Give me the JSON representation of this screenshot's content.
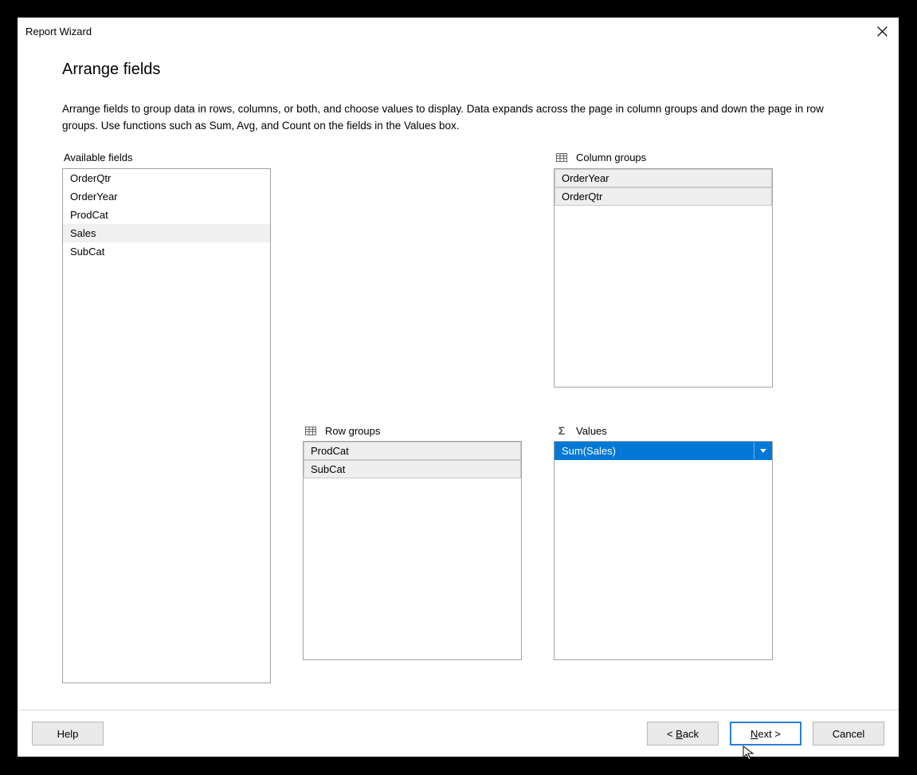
{
  "window": {
    "title": "Report Wizard"
  },
  "page": {
    "heading": "Arrange fields",
    "description": "Arrange fields to group data in rows, columns, or both, and choose values to display. Data expands across the page in column groups and down the page in row groups.  Use functions such as Sum, Avg, and Count on the fields in the Values box."
  },
  "labels": {
    "available": "Available fields",
    "column_groups": "Column groups",
    "row_groups": "Row groups",
    "values": "Values"
  },
  "available_fields": [
    {
      "name": "OrderQtr",
      "selected": false
    },
    {
      "name": "OrderYear",
      "selected": false
    },
    {
      "name": "ProdCat",
      "selected": false
    },
    {
      "name": "Sales",
      "selected": true
    },
    {
      "name": "SubCat",
      "selected": false
    }
  ],
  "column_groups": [
    {
      "name": "OrderYear"
    },
    {
      "name": "OrderQtr"
    }
  ],
  "row_groups": [
    {
      "name": "ProdCat"
    },
    {
      "name": "SubCat"
    }
  ],
  "values": [
    {
      "name": "Sum(Sales)",
      "selected": true
    }
  ],
  "buttons": {
    "help": "Help",
    "back_prefix": "< ",
    "back_u": "B",
    "back_rest": "ack",
    "next_u": "N",
    "next_rest": "ext >",
    "cancel": "Cancel"
  }
}
